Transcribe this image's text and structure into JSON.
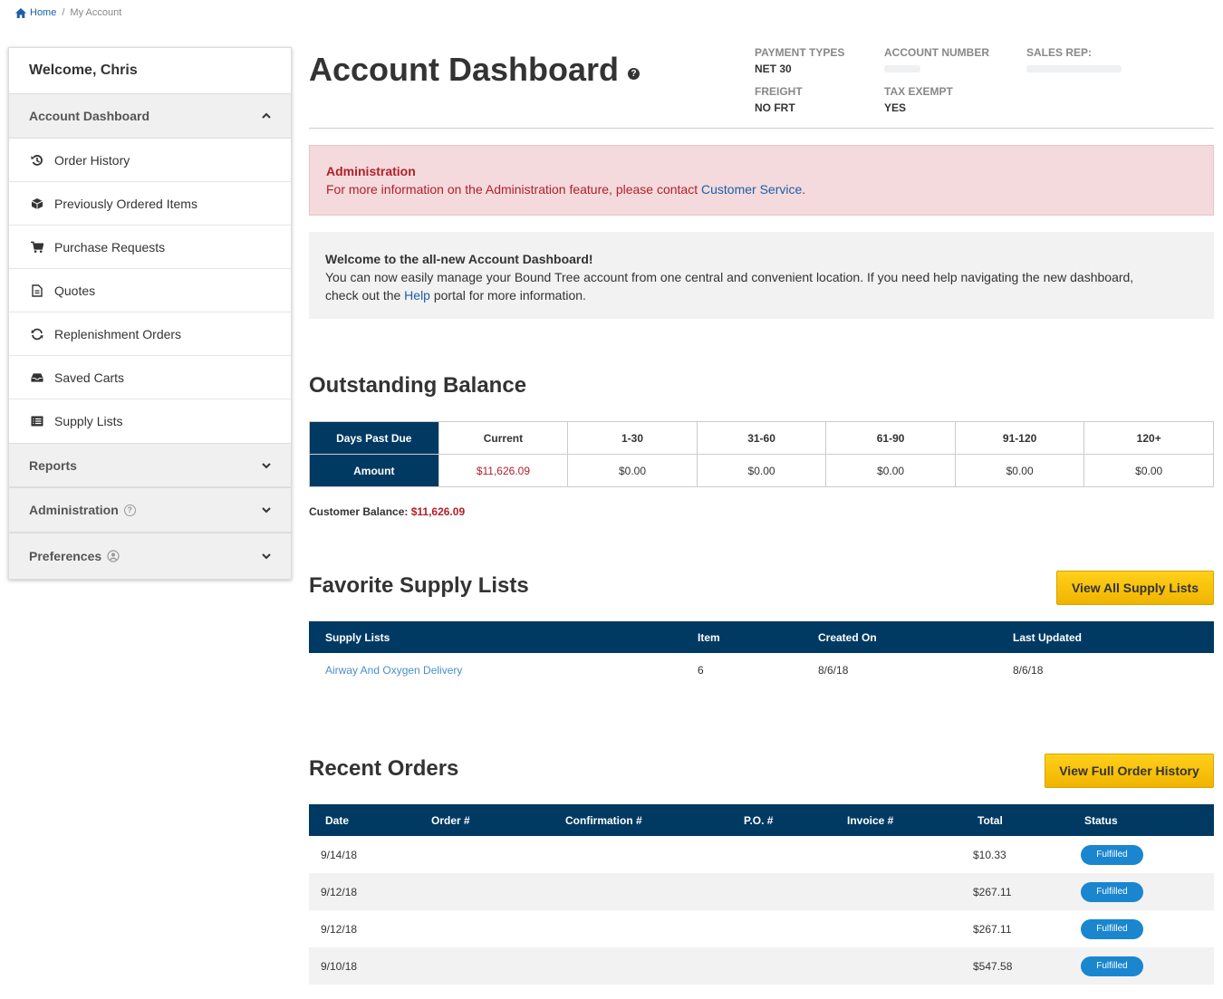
{
  "breadcrumb": {
    "home": "Home",
    "separator": "/",
    "current": "My Account"
  },
  "sidebar": {
    "welcome": "Welcome, Chris",
    "sections": {
      "dashboard": "Account Dashboard",
      "reports": "Reports",
      "administration": "Administration",
      "preferences": "Preferences"
    },
    "items": [
      {
        "label": "Order History",
        "icon": "history-icon"
      },
      {
        "label": "Previously Ordered Items",
        "icon": "box-icon"
      },
      {
        "label": "Purchase Requests",
        "icon": "cart-icon"
      },
      {
        "label": "Quotes",
        "icon": "document-icon"
      },
      {
        "label": "Replenishment Orders",
        "icon": "refresh-icon"
      },
      {
        "label": "Saved Carts",
        "icon": "inbox-icon"
      },
      {
        "label": "Supply Lists",
        "icon": "list-icon"
      }
    ]
  },
  "header": {
    "title": "Account Dashboard",
    "help_glyph": "?",
    "payment_types_label": "PAYMENT TYPES",
    "payment_types_value": "NET 30",
    "account_number_label": "ACCOUNT NUMBER",
    "sales_rep_label": "SALES REP:",
    "freight_label": "FREIGHT",
    "freight_value": "NO FRT",
    "tax_exempt_label": "TAX EXEMPT",
    "tax_exempt_value": "YES"
  },
  "alert": {
    "title": "Administration",
    "text": "For more information on the Administration feature, please contact ",
    "link": "Customer Service",
    "end": "."
  },
  "info": {
    "title": "Welcome to the all-new Account Dashboard!",
    "text1": "You can now easily manage your Bound Tree account from one central and convenient location. If you need help navigating the new dashboard,",
    "text2a": "check out the ",
    "link": "Help",
    "text2b": " portal for more information."
  },
  "balance": {
    "heading": "Outstanding Balance",
    "row_headers": [
      "Days Past Due",
      "Amount"
    ],
    "columns": [
      "Current",
      "1-30",
      "31-60",
      "61-90",
      "91-120",
      "120+"
    ],
    "amounts": [
      "$11,626.09",
      "$0.00",
      "$0.00",
      "$0.00",
      "$0.00",
      "$0.00"
    ],
    "customer_balance_label": "Customer Balance:",
    "customer_balance_value": "$11,626.09"
  },
  "supply_lists": {
    "heading": "Favorite Supply Lists",
    "button": "View All Supply Lists",
    "columns": [
      "Supply Lists",
      "Item",
      "Created On",
      "Last Updated"
    ],
    "rows": [
      {
        "name": "Airway And Oxygen Delivery",
        "items": "6",
        "created": "8/6/18",
        "updated": "8/6/18"
      }
    ]
  },
  "orders": {
    "heading": "Recent Orders",
    "button": "View Full Order History",
    "columns": [
      "Date",
      "Order #",
      "Confirmation #",
      "P.O. #",
      "Invoice #",
      "Total",
      "Status"
    ],
    "rows": [
      {
        "date": "9/14/18",
        "total": "$10.33",
        "status": "Fulfilled"
      },
      {
        "date": "9/12/18",
        "total": "$267.11",
        "status": "Fulfilled"
      },
      {
        "date": "9/12/18",
        "total": "$267.11",
        "status": "Fulfilled"
      },
      {
        "date": "9/10/18",
        "total": "$547.58",
        "status": "Fulfilled"
      }
    ]
  },
  "colors": {
    "navy": "#003a63",
    "accent_yellow": "#f5c000",
    "alert_red": "#b2202a",
    "link_blue": "#1a5fa8",
    "badge_blue": "#1a86d0"
  }
}
